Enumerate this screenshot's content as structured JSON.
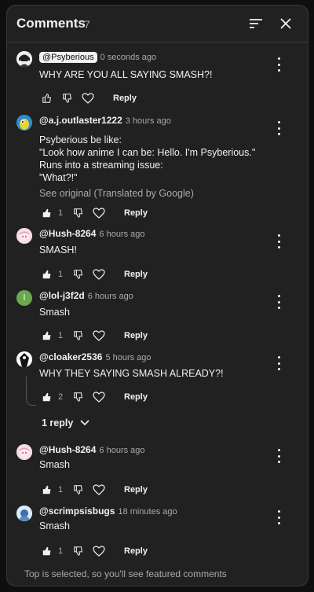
{
  "header": {
    "title": "Comments",
    "count": "7"
  },
  "actions": {
    "reply_label": "Reply"
  },
  "comments": [
    {
      "handle": "@Psyberious",
      "time": "0 seconds ago",
      "lines": [
        "WHY ARE YOU ALL SAYING SMASH?!"
      ],
      "likes": "",
      "avatar": "psyberious-avatar"
    },
    {
      "handle": "@a.j.outlaster1222",
      "time": "3 hours ago",
      "lines": [
        "Psyberious be like:",
        "\"Look how anime I can be: Hello. I'm Psyberious.\"",
        "Runs into a streaming issue:",
        "\"What?!\""
      ],
      "translation": "See original (Translated by Google)",
      "likes": "1",
      "avatar": "parrot-avatar"
    },
    {
      "handle": "@Hush-8264",
      "time": "6 hours ago",
      "lines": [
        "SMASH!"
      ],
      "likes": "1",
      "avatar": "anime-avatar"
    },
    {
      "handle": "@lol-j3f2d",
      "time": "6 hours ago",
      "lines": [
        "Smash"
      ],
      "likes": "1",
      "avatar": "letter-avatar",
      "avatar_letter": "l",
      "avatar_color": "#6aa84f"
    },
    {
      "handle": "@cloaker2536",
      "time": "5 hours ago",
      "lines": [
        "WHY THEY SAYING SMASH ALREADY?!"
      ],
      "likes": "2",
      "avatar": "cloaker-avatar",
      "replies_label": "1 reply"
    },
    {
      "handle": "@Hush-8264",
      "time": "6 hours ago",
      "lines": [
        "Smash"
      ],
      "likes": "1",
      "avatar": "anime-avatar"
    },
    {
      "handle": "@scrimpsisbugs",
      "time": "18 minutes ago",
      "lines": [
        "Smash"
      ],
      "likes": "1",
      "avatar": "scrimp-avatar"
    }
  ],
  "footer": {
    "text": "Top is selected, so you'll see featured comments"
  }
}
